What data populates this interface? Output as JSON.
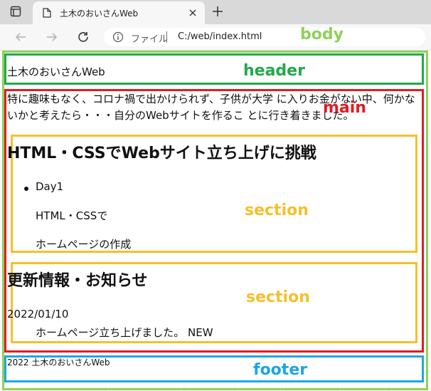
{
  "browser": {
    "tab": {
      "title": "土木のおいさんWeb"
    },
    "address": {
      "site_label": "ファイル",
      "url": "C:/web/index.html"
    }
  },
  "annotations": {
    "body": "body",
    "header": "header",
    "main": "main",
    "section1": "section",
    "section2": "section",
    "footer": "footer"
  },
  "colors": {
    "body": "#8fd15a",
    "header": "#22a94a",
    "main": "#e01b24",
    "section": "#f4c02c",
    "footer": "#1da5e6"
  },
  "page": {
    "header_title": "土木のおいさんWeb",
    "intro": "特に趣味もなく、コロナ禍で出かけられず、子供が大学 に入りお金がない中、何かないかと考えたら・・・自分のWebサイトを作るこ とに行き着きました。",
    "section1": {
      "heading": "HTML・CSSでWebサイト立ち上げに挑戦",
      "list_item": "Day1",
      "para1": "HTML・CSSで",
      "para2": "ホームページの作成"
    },
    "section2": {
      "heading": "更新情報・お知らせ",
      "date": "2022/01/10",
      "item": "ホームページ立ち上げました。 NEW"
    },
    "footer": "2022 土木のおいさんWeb"
  }
}
